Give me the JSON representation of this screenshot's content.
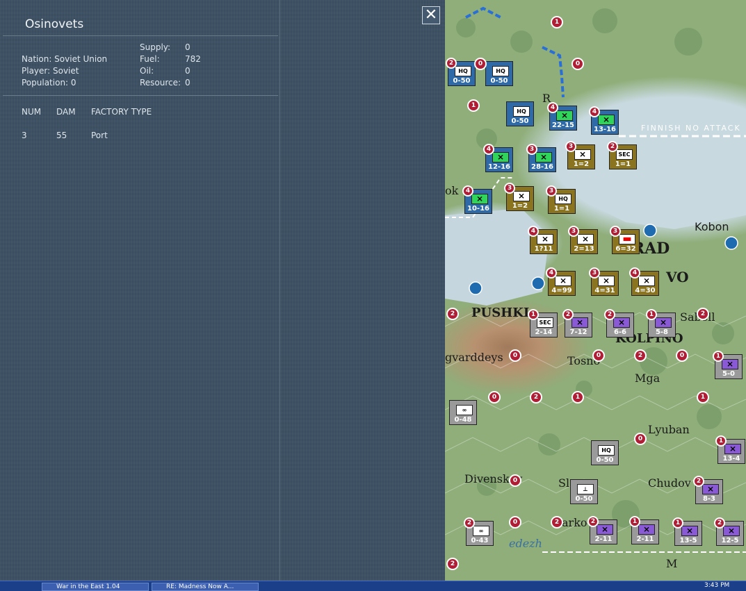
{
  "panel": {
    "city_name": "Osinovets",
    "nation_label": "Nation: Soviet Union",
    "player_label": "Player: Soviet",
    "population_label": "Population: 0",
    "supply_label": "Supply:",
    "supply_value": "0",
    "fuel_label": "Fuel:",
    "fuel_value": "782",
    "oil_label": "Oil:",
    "oil_value": "0",
    "resource_label": "Resource:",
    "resource_value": "0",
    "columns": [
      "NUM",
      "DAM",
      "FACTORY TYPE"
    ],
    "rows": [
      {
        "num": "3",
        "dam": "55",
        "type": "Port"
      }
    ],
    "close_glyph": "✕"
  },
  "map": {
    "labels": {
      "finnish": "FINNISH NO ATTACK",
      "kobona": "Kobon",
      "grad": "GRAD",
      "vo": "VO",
      "pushkin": "PUSHKI",
      "kolpino": "KOLPINO",
      "sabelli": "Sabell",
      "gvard": "gvarddeys",
      "tosno": "Tosno",
      "mga": "Mga",
      "lyuban": "Lyuban",
      "divenska": "Divenskay",
      "chudovo": "Chudov",
      "slya": "Sl",
      "varka": "arko",
      "medezh": "edezh",
      "mal": "M",
      "ok": "ok",
      "ros": "R"
    },
    "units": [
      {
        "id": "u1",
        "cls": "blue",
        "sym": "HQ",
        "str": "0-50",
        "badge": "2"
      },
      {
        "id": "u2",
        "cls": "blue",
        "sym": "HQ",
        "str": "0-50",
        "badge": ""
      },
      {
        "id": "u3",
        "cls": "blue",
        "sym": "HQ",
        "str": "0-50",
        "badge": ""
      },
      {
        "id": "u4",
        "cls": "blue",
        "sym": "⨯",
        "str": "22-15",
        "badge": "4"
      },
      {
        "id": "u5",
        "cls": "blue",
        "sym": "⨯",
        "str": "13-16",
        "badge": "4"
      },
      {
        "id": "u6",
        "cls": "blue",
        "sym": "⨯",
        "str": "12-16",
        "badge": "4"
      },
      {
        "id": "u7",
        "cls": "blue",
        "sym": "⨯",
        "str": "28-16",
        "badge": "3"
      },
      {
        "id": "u8",
        "cls": "gold",
        "sym": "⨯",
        "str": "1=2",
        "badge": "3"
      },
      {
        "id": "u9",
        "cls": "gold",
        "sym": "SEC",
        "str": "1=1",
        "badge": "2"
      },
      {
        "id": "u10",
        "cls": "blue",
        "sym": "⨯",
        "str": "10-16",
        "badge": "4"
      },
      {
        "id": "u11",
        "cls": "gold",
        "sym": "⨯",
        "str": "1=2",
        "badge": "3"
      },
      {
        "id": "u12",
        "cls": "gold",
        "sym": "HQ",
        "str": "1=1",
        "badge": "3"
      },
      {
        "id": "u13",
        "cls": "gold",
        "sym": "⨯",
        "str": "1?11",
        "badge": "4"
      },
      {
        "id": "u14",
        "cls": "gold",
        "sym": "⨯",
        "str": "2=13",
        "badge": "3"
      },
      {
        "id": "u15",
        "cls": "gold",
        "sym": "▬",
        "str": "6=32",
        "badge": "3"
      },
      {
        "id": "u16",
        "cls": "gold",
        "sym": "⨯",
        "str": "4=99",
        "badge": "4"
      },
      {
        "id": "u17",
        "cls": "gold",
        "sym": "⨯",
        "str": "4=31",
        "badge": "3"
      },
      {
        "id": "u18",
        "cls": "gold",
        "sym": "⨯",
        "str": "4=30",
        "badge": "4"
      },
      {
        "id": "u19",
        "cls": "gray",
        "sym": "SEC",
        "str": "2-14",
        "badge": "1"
      },
      {
        "id": "u20",
        "cls": "gray",
        "sym": "⨯",
        "str": "7-12",
        "badge": "2"
      },
      {
        "id": "u21",
        "cls": "gray",
        "sym": "⨯",
        "str": "6-6",
        "badge": "2"
      },
      {
        "id": "u22",
        "cls": "gray",
        "sym": "⨯",
        "str": "5-8",
        "badge": "1"
      },
      {
        "id": "u23",
        "cls": "gray",
        "sym": "⨯",
        "str": "5-0",
        "badge": "1"
      },
      {
        "id": "u24",
        "cls": "gray",
        "sym": "∞",
        "str": "0-48",
        "badge": ""
      },
      {
        "id": "u25",
        "cls": "gray",
        "sym": "HQ",
        "str": "0-50",
        "badge": ""
      },
      {
        "id": "u26",
        "cls": "gray",
        "sym": "⨯",
        "str": "13-4",
        "badge": "1"
      },
      {
        "id": "u27",
        "cls": "gray",
        "sym": "⨯",
        "str": "8-3",
        "badge": "2"
      },
      {
        "id": "u28",
        "cls": "gray",
        "sym": "⊥",
        "str": "0-50",
        "badge": ""
      },
      {
        "id": "u29",
        "cls": "gray",
        "sym": "∞",
        "str": "0-43",
        "badge": "2"
      },
      {
        "id": "u30",
        "cls": "gray",
        "sym": "⨯",
        "str": "2-11",
        "badge": "2"
      },
      {
        "id": "u31",
        "cls": "gray",
        "sym": "⨯",
        "str": "2-11",
        "badge": "1"
      },
      {
        "id": "u32",
        "cls": "gray",
        "sym": "⨯",
        "str": "13-5",
        "badge": "1"
      },
      {
        "id": "u33",
        "cls": "gray",
        "sym": "⨯",
        "str": "12-5",
        "badge": "2"
      }
    ],
    "markers": [
      "1",
      "0",
      "1",
      "0",
      "2",
      "0",
      "0",
      "2",
      "0",
      "1",
      "2",
      "0",
      "2",
      "1",
      "0",
      "0",
      "2",
      "0",
      "2",
      "0",
      "0",
      "0",
      "2",
      "2",
      "1",
      "0",
      "1"
    ]
  },
  "taskbar": {
    "task1": "War in the East 1.04",
    "task2": "RE: Madness Now A...",
    "clock": "3:43 PM"
  }
}
